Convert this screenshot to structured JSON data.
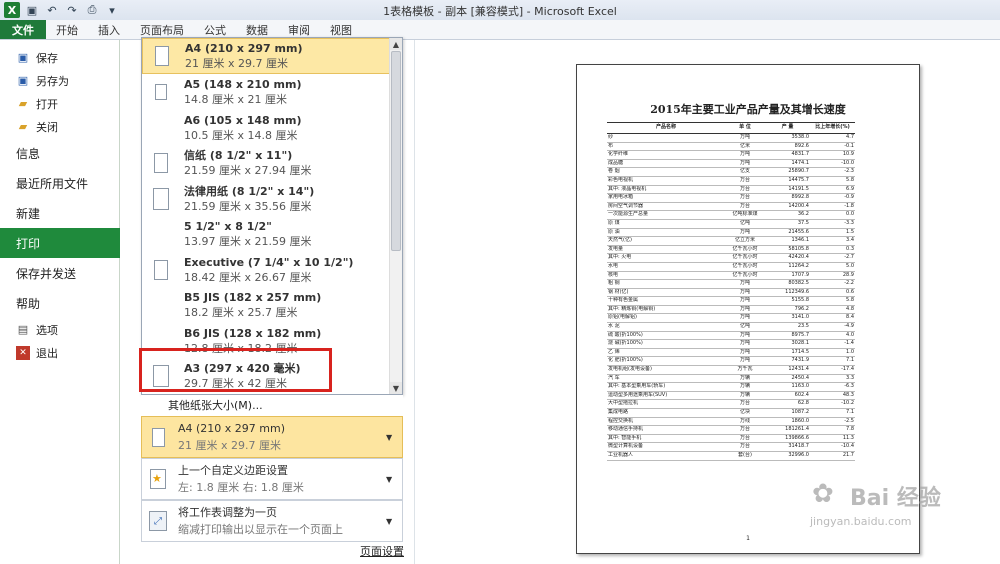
{
  "window": {
    "title": "1表格模板 - 副本 [兼容模式] - Microsoft Excel"
  },
  "ribbon_tabs": [
    "文件",
    "开始",
    "插入",
    "页面布局",
    "公式",
    "数据",
    "审阅",
    "视图"
  ],
  "nav": {
    "small_items": [
      {
        "label": "保存",
        "icon": "save-icon"
      },
      {
        "label": "另存为",
        "icon": "save-as-icon"
      },
      {
        "label": "打开",
        "icon": "open-folder-icon"
      },
      {
        "label": "关闭",
        "icon": "close-folder-icon"
      }
    ],
    "big_items": [
      "信息",
      "最近所用文件",
      "新建",
      "打印",
      "保存并发送",
      "帮助"
    ],
    "active": "打印",
    "bottom_items": [
      {
        "label": "选项",
        "icon": "options-icon"
      },
      {
        "label": "退出",
        "icon": "exit-icon"
      }
    ]
  },
  "paper_sizes": [
    {
      "name": "A4 (210 x 297 mm)",
      "size": "21 厘米 x 29.7 厘米",
      "selected": true
    },
    {
      "name": "A5 (148 x 210 mm)",
      "size": "14.8 厘米 x 21 厘米"
    },
    {
      "name": "A6 (105 x 148 mm)",
      "size": "10.5 厘米 x 14.8 厘米"
    },
    {
      "name": "信纸 (8 1/2\" x 11\")",
      "size": "21.59 厘米 x 27.94 厘米"
    },
    {
      "name": "法律用纸 (8 1/2\" x 14\")",
      "size": "21.59 厘米 x 35.56 厘米"
    },
    {
      "name": "5 1/2\" x 8 1/2\"",
      "size": "13.97 厘米 x 21.59 厘米"
    },
    {
      "name": "Executive (7 1/4\" x 10 1/2\")",
      "size": "18.42 厘米 x 26.67 厘米"
    },
    {
      "name": "B5 JIS (182 x 257 mm)",
      "size": "18.2 厘米 x 25.7 厘米"
    },
    {
      "name": "B6 JIS (128 x 182 mm)",
      "size": "12.8 厘米 x 18.2 厘米"
    },
    {
      "name": "A3 (297 x 420 毫米)",
      "size": "29.7 厘米 x 42 厘米"
    }
  ],
  "more_sizes": "其他纸张大小(M)...",
  "settings": {
    "paper": {
      "main": "A4 (210 x 297 mm)",
      "sub": "21 厘米 x 29.7 厘米"
    },
    "margins": {
      "main": "上一个自定义边距设置",
      "sub": "左:  1.8 厘米    右:  1.8 厘米"
    },
    "scaling": {
      "main": "将工作表调整为一页",
      "sub": "缩减打印输出以显示在一个页面上"
    }
  },
  "page_setup_link": "页面设置",
  "preview": {
    "doc_title": "2015年主要工业产品产量及其增长速度",
    "headers": [
      "产品名称",
      "单 位",
      "产 量",
      "比上年增长(%)"
    ],
    "rows": [
      [
        "纱",
        "万吨",
        "3538.0",
        "4.7"
      ],
      [
        "布",
        "亿米",
        "892.6",
        "-0.1"
      ],
      [
        "化学纤维",
        "万吨",
        "4831.7",
        "10.9"
      ],
      [
        "成品糖",
        "万吨",
        "1474.1",
        "-10.0"
      ],
      [
        "卷 烟",
        "亿支",
        "25890.7",
        "-2.3"
      ],
      [
        "彩色电视机",
        "万台",
        "14475.7",
        "5.8"
      ],
      [
        "  其中: 液晶电视机",
        "万台",
        "14191.5",
        "6.9"
      ],
      [
        "家用电冰箱",
        "万台",
        "8992.8",
        "-0.9"
      ],
      [
        "房间空气调节器",
        "万台",
        "14200.4",
        "-1.8"
      ],
      [
        "一次能源生产总量",
        "亿吨标准煤",
        "36.2",
        "0.0"
      ],
      [
        "原 煤",
        "亿吨",
        "37.5",
        "-3.3"
      ],
      [
        "原 油",
        "万吨",
        "21455.6",
        "1.5"
      ],
      [
        "天然气(亿)",
        "亿立方米",
        "1346.1",
        "3.4"
      ],
      [
        "发电量",
        "亿千瓦小时",
        "58105.8",
        "0.3"
      ],
      [
        "    其中: 火电",
        "亿千瓦小时",
        "42420.4",
        "-2.7"
      ],
      [
        "        水电",
        "亿千瓦小时",
        "11264.2",
        "5.0"
      ],
      [
        "        核电",
        "亿千瓦小时",
        "1707.9",
        "28.9"
      ],
      [
        "粗 钢",
        "万吨",
        "80382.5",
        "-2.2"
      ],
      [
        "钢 材(亿)",
        "万吨",
        "112349.6",
        "0.6"
      ],
      [
        "十种有色金属",
        "万吨",
        "5155.8",
        "5.8"
      ],
      [
        "  其中: 精炼铜(电解铜)",
        "万吨",
        "796.2",
        "4.8"
      ],
      [
        "原铝(电解铝)",
        "万吨",
        "3141.0",
        "8.4"
      ],
      [
        "水 泥",
        "亿吨",
        "23.5",
        "-4.9"
      ],
      [
        "硫 酸(折100%)",
        "万吨",
        "8975.7",
        "4.0"
      ],
      [
        "烧 碱(折100%)",
        "万吨",
        "3028.1",
        "-1.4"
      ],
      [
        "乙 烯",
        "万吨",
        "1714.5",
        "1.0"
      ],
      [
        "化 肥(折100%)",
        "万吨",
        "7431.9",
        "7.1"
      ],
      [
        "发电机组(发电设备)",
        "万千瓦",
        "12431.4",
        "-17.4"
      ],
      [
        "汽 车",
        "万辆",
        "2450.4",
        "3.3"
      ],
      [
        "  其中: 基本型乘用车(轿车)",
        "万辆",
        "1163.0",
        "-6.3"
      ],
      [
        "     运动型多用途乘用车(SUV)",
        "万辆",
        "602.4",
        "48.3"
      ],
      [
        "大中型拖拉机",
        "万台",
        "62.8",
        "-10.2"
      ],
      [
        "集成电路",
        "亿块",
        "1087.2",
        "7.1"
      ],
      [
        "程控交换机",
        "万线",
        "1860.0",
        "-2.5"
      ],
      [
        "移动通信手持机",
        "万台",
        "181261.4",
        "7.8"
      ],
      [
        "  其中: 智能手机",
        "万台",
        "139866.6",
        "11.3"
      ],
      [
        "微型计算机设备",
        "万台",
        "31418.7",
        "-10.4"
      ],
      [
        "工业机器人",
        "套(台)",
        "32996.0",
        "21.7"
      ]
    ],
    "page_number": "1"
  },
  "watermark": {
    "text": "Bai 经验",
    "url": "jingyan.baidu.com"
  }
}
